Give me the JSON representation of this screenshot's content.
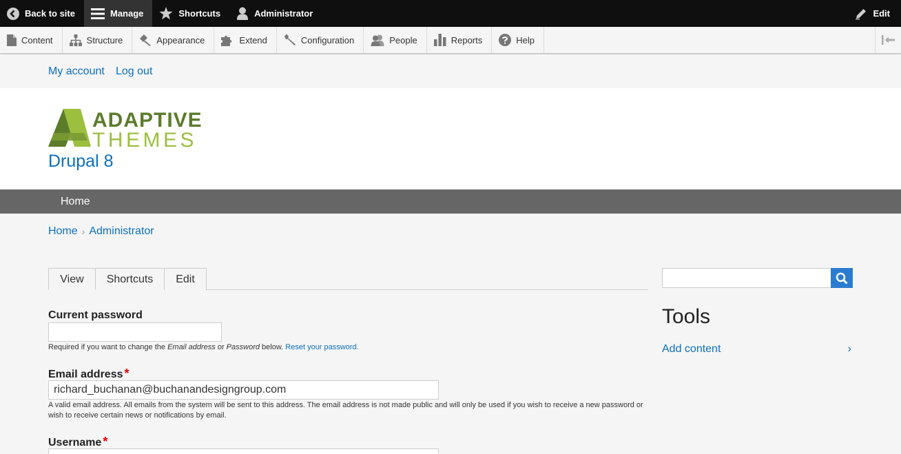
{
  "toolbar": {
    "back_to_site": "Back to site",
    "manage": "Manage",
    "shortcuts": "Shortcuts",
    "user": "Administrator",
    "edit": "Edit"
  },
  "tray": {
    "items": [
      "Content",
      "Structure",
      "Appearance",
      "Extend",
      "Configuration",
      "People",
      "Reports",
      "Help"
    ]
  },
  "secondary_menu": {
    "my_account": "My account",
    "log_out": "Log out"
  },
  "branding": {
    "logo_top": "ADAPTIVE",
    "logo_bottom": "THEMES",
    "site_name": "Drupal 8"
  },
  "main_nav": {
    "home": "Home"
  },
  "breadcrumb": {
    "home": "Home",
    "separator": "›",
    "current": "Administrator"
  },
  "tabs": [
    "View",
    "Shortcuts",
    "Edit"
  ],
  "form": {
    "current_password": {
      "label": "Current password",
      "value": "",
      "desc_prefix": "Required if you want to change the ",
      "desc_em1": "Email address",
      "desc_mid": " or ",
      "desc_em2": "Password",
      "desc_suffix": " below. ",
      "desc_link": "Reset your password."
    },
    "email": {
      "label": "Email address",
      "required_mark": "*",
      "value": "richard_buchanan@buchanandesigngroup.com",
      "desc_line1": "A valid email address. All emails from the system will be sent to this address. The email address is not made public and will only be used if you wish to receive a new password or",
      "desc_line2": "wish to receive certain news or notifications by email."
    },
    "username": {
      "label": "Username",
      "required_mark": "*"
    }
  },
  "sidebar": {
    "search_value": "",
    "tools_title": "Tools",
    "add_content": "Add content",
    "add_content_chevron": "›"
  },
  "colors": {
    "link": "#0b6fbf",
    "toolbar_bg": "#0f0f0f",
    "nav_bg": "#666666",
    "search_button": "#2a7cd1",
    "logo_dark_green": "#5b7c2a",
    "logo_light_green": "#9cbf3f"
  }
}
